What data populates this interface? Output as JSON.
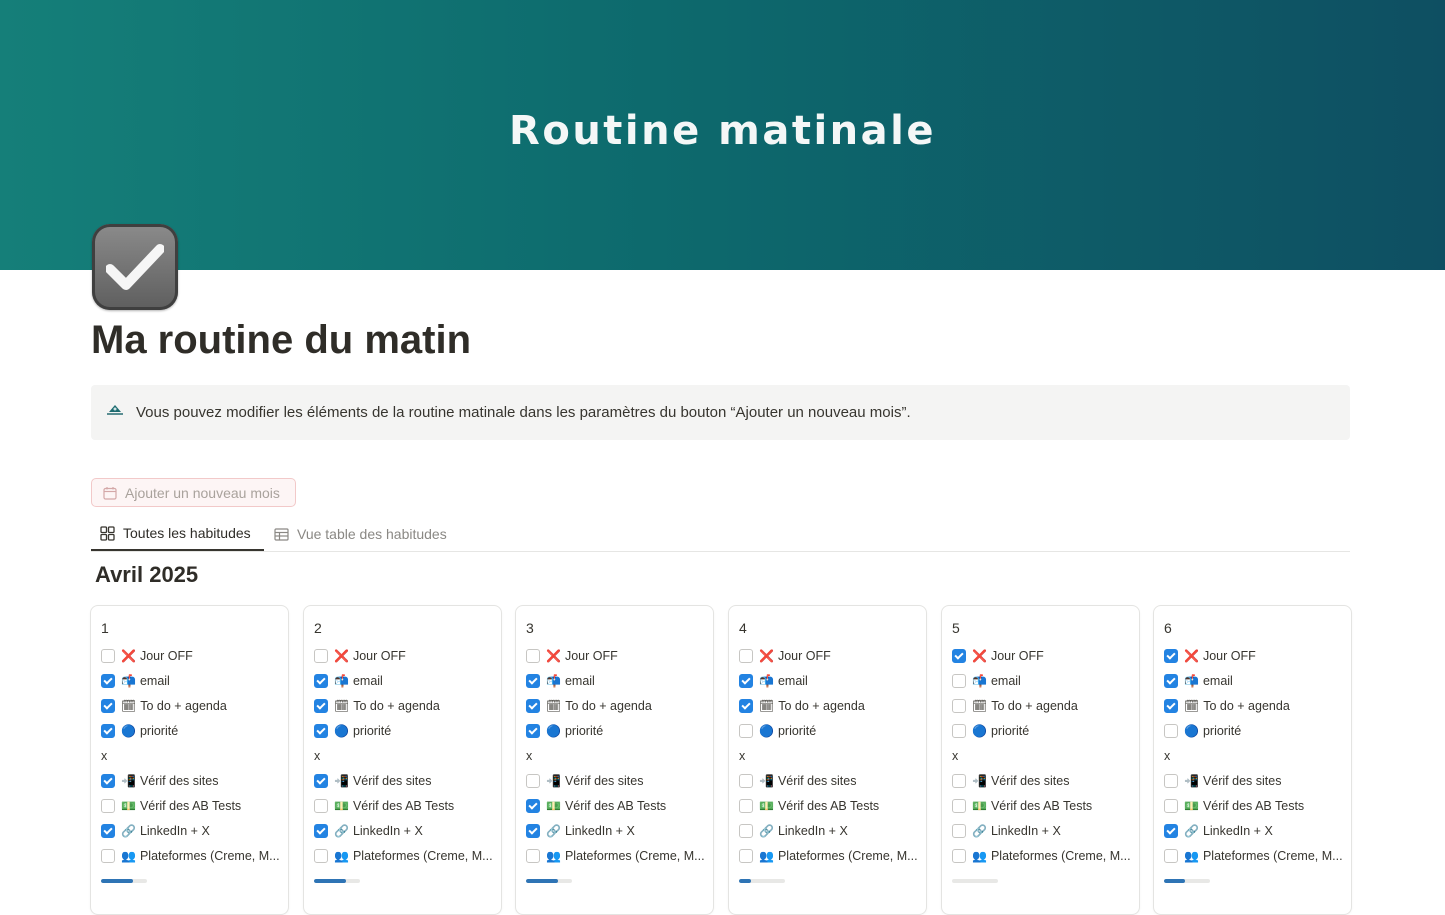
{
  "cover": {
    "title": "Routine matinale",
    "gradient": [
      "#157f79",
      "#0e4f62"
    ]
  },
  "page": {
    "icon": "checkbox-icon",
    "title": "Ma routine du matin"
  },
  "callout": {
    "icon": "notion-logo-icon",
    "text": "Vous pouvez modifier les éléments de la routine matinale dans les paramètres du bouton “Ajouter un nouveau mois”."
  },
  "add_button": {
    "icon": "calendar-icon",
    "label": "Ajouter un nouveau mois"
  },
  "tabs": [
    {
      "icon": "gallery-icon",
      "label": "Toutes les habitudes",
      "active": true
    },
    {
      "icon": "table-icon",
      "label": "Vue table des habitudes",
      "active": false
    }
  ],
  "group": {
    "title": "Avril 2025"
  },
  "habit_labels": {
    "jour_off": "Jour OFF",
    "email": "email",
    "todo": "To do + agenda",
    "priorite": "priorité",
    "separator": "x",
    "verif_sites": "Vérif des sites",
    "verif_ab": "Vérif des AB Tests",
    "linkedin": "LinkedIn + X",
    "plateformes": "Plateformes (Creme, M..."
  },
  "accent_color": "#2383e2",
  "cards": [
    {
      "day": "1",
      "checks": [
        false,
        true,
        true,
        true,
        true,
        false,
        true,
        false
      ],
      "progress": 0.7
    },
    {
      "day": "2",
      "checks": [
        false,
        true,
        true,
        true,
        true,
        false,
        true,
        false
      ],
      "progress": 0.7
    },
    {
      "day": "3",
      "checks": [
        false,
        true,
        true,
        true,
        false,
        true,
        true,
        false
      ],
      "progress": 0.7
    },
    {
      "day": "4",
      "checks": [
        false,
        true,
        true,
        false,
        false,
        false,
        false,
        false
      ],
      "progress": 0.25
    },
    {
      "day": "5",
      "checks": [
        true,
        false,
        false,
        false,
        false,
        false,
        false,
        false
      ],
      "progress": 0
    },
    {
      "day": "6",
      "checks": [
        true,
        true,
        true,
        false,
        false,
        false,
        true,
        false
      ],
      "progress": 0.45
    }
  ]
}
